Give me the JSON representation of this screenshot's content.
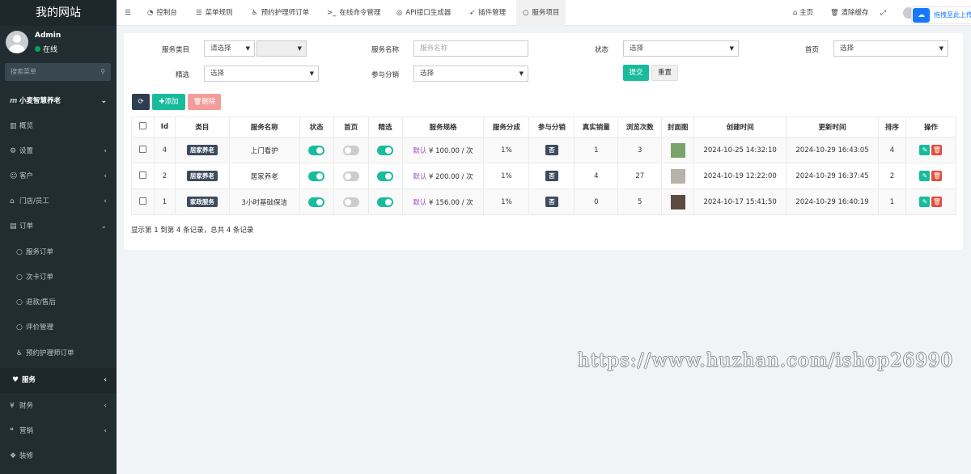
{
  "app": {
    "title": "我的网站"
  },
  "user": {
    "name": "Admin",
    "status": "在线"
  },
  "sidebar": {
    "search_placeholder": "搜索菜单",
    "items": [
      {
        "label": "小麦智慧养老",
        "icon": "m"
      },
      {
        "label": "概览",
        "icon": "chart-icon"
      },
      {
        "label": "设置",
        "icon": "gear-icon"
      },
      {
        "label": "客户",
        "icon": "user-icon"
      },
      {
        "label": "门店/员工",
        "icon": "bank-icon"
      },
      {
        "label": "订单",
        "icon": "file-icon"
      },
      {
        "label": "服务订单",
        "icon": "circle-icon"
      },
      {
        "label": "次卡订单",
        "icon": "circle-icon"
      },
      {
        "label": "退款/售后",
        "icon": "circle-icon"
      },
      {
        "label": "评价管理",
        "icon": "circle-icon"
      },
      {
        "label": "预约护理师订单",
        "icon": "wheelchair-icon"
      },
      {
        "label": "服务",
        "icon": "heart-icon"
      },
      {
        "label": "财务",
        "icon": "yen-icon"
      },
      {
        "label": "营销",
        "icon": "comments-icon"
      },
      {
        "label": "装修",
        "icon": "paint-icon"
      }
    ]
  },
  "topbar": {
    "tabs": [
      {
        "label": "控制台",
        "icon": "dashboard-icon"
      },
      {
        "label": "菜单规则",
        "icon": "list-icon"
      },
      {
        "label": "预约护理师订单",
        "icon": "wheelchair-icon"
      },
      {
        "label": "在线命令管理",
        "icon": "terminal-icon"
      },
      {
        "label": "API接口生成器",
        "icon": "api-icon"
      },
      {
        "label": "插件管理",
        "icon": "rocket-icon"
      },
      {
        "label": "服务项目",
        "icon": "circle-icon"
      }
    ],
    "home": "主页",
    "clear_cache": "清除缓存",
    "extension": "拖拽至此上传"
  },
  "filters": {
    "category_label": "服务类目",
    "category_value": "请选择",
    "name_label": "服务名称",
    "name_placeholder": "服务名称",
    "status_label": "状态",
    "status_value": "选择",
    "home_label": "首页",
    "home_value": "选择",
    "featured_label": "精选",
    "featured_value": "选择",
    "distribution_label": "参与分销",
    "distribution_value": "选择",
    "submit": "提交",
    "reset": "重置"
  },
  "toolbar": {
    "add": "添加",
    "delete": "删除"
  },
  "table": {
    "headers": [
      "Id",
      "类目",
      "服务名称",
      "状态",
      "首页",
      "精选",
      "服务规格",
      "服务分成",
      "参与分销",
      "真实销量",
      "浏览次数",
      "封面图",
      "创建时间",
      "更新时间",
      "排序",
      "操作"
    ],
    "rows": [
      {
        "id": "4",
        "category": "居家养老",
        "name": "上门看护",
        "status": true,
        "home": false,
        "featured": true,
        "spec_label": "默认",
        "spec_price": "¥ 100.00 / 次",
        "commission": "1%",
        "distribution": "否",
        "sales": "1",
        "views": "3",
        "created": "2024-10-25 14:32:10",
        "updated": "2024-10-29 16:43:05",
        "sort": "4",
        "thumb": "#7aa36a"
      },
      {
        "id": "2",
        "category": "居家养老",
        "name": "居家养老",
        "status": true,
        "home": false,
        "featured": true,
        "spec_label": "默认",
        "spec_price": "¥ 200.00 / 次",
        "commission": "1%",
        "distribution": "否",
        "sales": "4",
        "views": "27",
        "created": "2024-10-19 12:22:00",
        "updated": "2024-10-29 16:37:45",
        "sort": "2",
        "thumb": "#b9b2a8"
      },
      {
        "id": "1",
        "category": "家政服务",
        "name": "3小时基础保洁",
        "status": true,
        "home": false,
        "featured": true,
        "spec_label": "默认",
        "spec_price": "¥ 156.00 / 次",
        "commission": "1%",
        "distribution": "否",
        "sales": "0",
        "views": "5",
        "created": "2024-10-17 15:41:50",
        "updated": "2024-10-29 16:40:19",
        "sort": "1",
        "thumb": "#5a4a40"
      }
    ],
    "summary": "显示第 1 到第 4 条记录，总共 4 条记录"
  },
  "watermark": "https://www.huzhan.com/ishop26990",
  "colors": {
    "sidebar": "#222d32",
    "accent": "#18bc9c",
    "danger": "#e74c3c",
    "tag": "#3c4a5c"
  }
}
